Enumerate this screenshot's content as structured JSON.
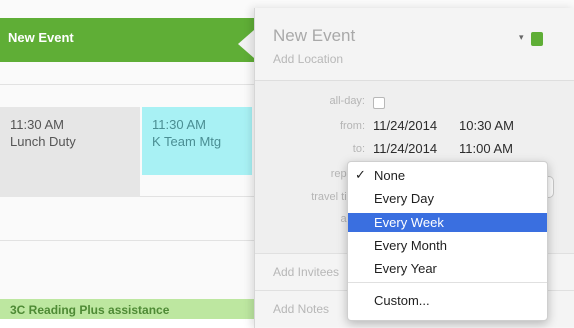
{
  "calendar": {
    "new_event_label": "New Event",
    "events": [
      {
        "time": "11:30 AM",
        "title": "Lunch Duty"
      },
      {
        "time": "11:30 AM",
        "title": "K Team Mtg"
      }
    ],
    "bottom_event": "3C Reading Plus assistance"
  },
  "popover": {
    "title": "New Event",
    "location_placeholder": "Add Location",
    "fields": {
      "all_day_label": "all-day:",
      "from_label": "from:",
      "from_date": "11/24/2014",
      "from_time": "10:30 AM",
      "to_label": "to:",
      "to_date": "11/24/2014",
      "to_time": "11:00 AM",
      "repeat_label": "repeat:",
      "travel_label": "travel time:",
      "alert_label": "alert:"
    },
    "add_invitees": "Add Invitees",
    "add_notes": "Add Notes",
    "calendar_color": "#5fae36"
  },
  "repeat_menu": {
    "items": [
      "None",
      "Every Day",
      "Every Week",
      "Every Month",
      "Every Year"
    ],
    "custom": "Custom...",
    "checked": "None",
    "highlighted": "Every Week",
    "check_glyph": "✓"
  }
}
